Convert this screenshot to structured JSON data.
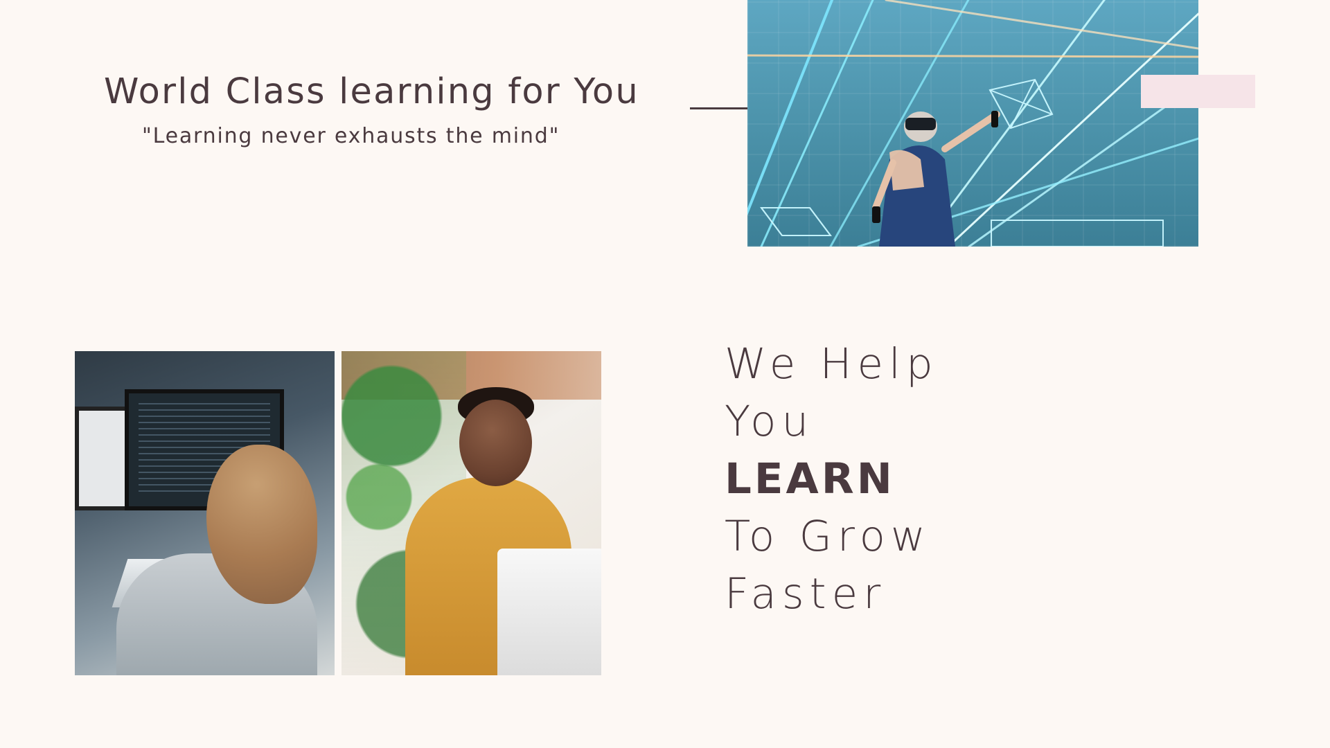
{
  "hero": {
    "title": "World Class learning for You",
    "subtitle": "\"Learning never exhausts the mind\""
  },
  "headline": {
    "lines": [
      "We Help",
      "You",
      "LEARN",
      "To Grow",
      "Faster"
    ]
  },
  "colors": {
    "background": "#fdf8f4",
    "text": "#4a3a3f",
    "accent": "#f6e4e8"
  }
}
